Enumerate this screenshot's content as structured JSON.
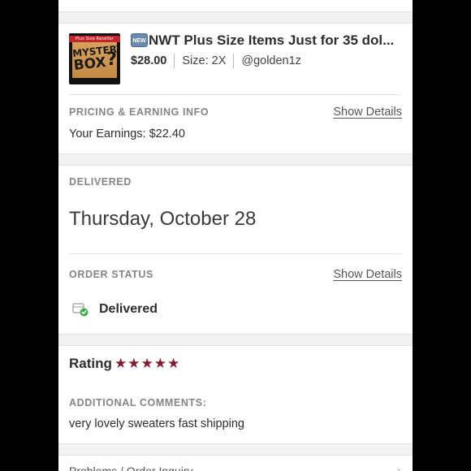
{
  "product": {
    "image_label": "Plus Size Reseller",
    "image_text_line1": "MYSTERY",
    "image_text_line2": "BOX",
    "image_text_q": "?",
    "badge": "NEW",
    "title": "NWT Plus Size Items Just for 35 dol...",
    "price": "$28.00",
    "size": "Size: 2X",
    "seller": "@golden1z"
  },
  "pricing": {
    "label": "PRICING & EARNING INFO",
    "show_details": "Show Details",
    "earnings": "Your Earnings: $22.40"
  },
  "delivery": {
    "label": "DELIVERED",
    "date": "Thursday, October 28"
  },
  "order_status": {
    "label": "ORDER STATUS",
    "show_details": "Show Details",
    "status": "Delivered"
  },
  "rating": {
    "label": "Rating",
    "stars": 5,
    "stars_display": "★★★★★",
    "star_color": "#7f1d2d"
  },
  "comments": {
    "label": "ADDITIONAL COMMENTS:",
    "text": "very lovely sweaters fast shipping"
  },
  "footer": {
    "problems_link": "Problems / Order Inquiry",
    "chevron": "›"
  }
}
